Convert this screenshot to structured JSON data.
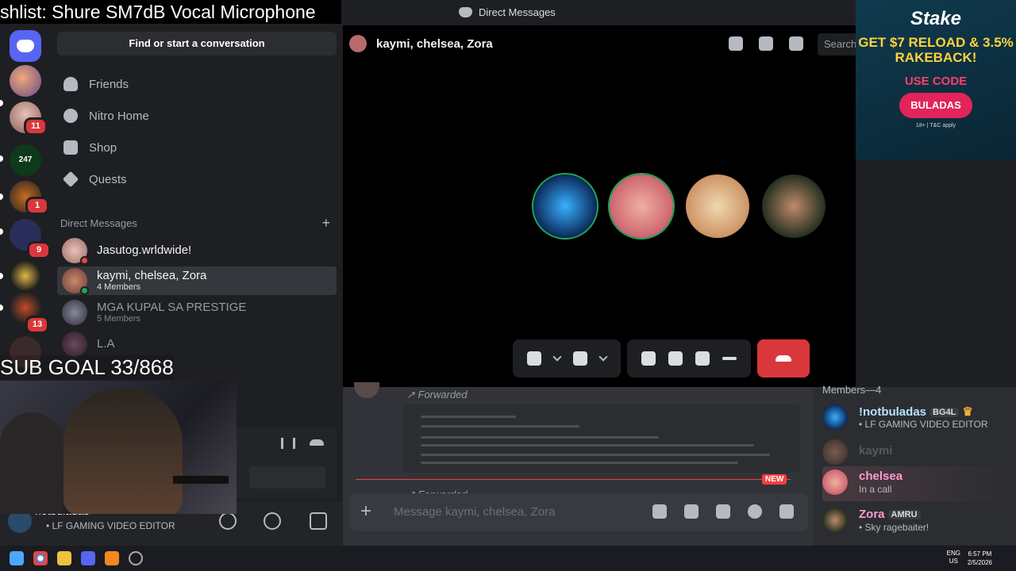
{
  "stream": {
    "title": "shlist: Shure SM7dB Vocal Microphone",
    "sub_goal": "SUB GOAL 33/868"
  },
  "window": {
    "title": "Direct Messages"
  },
  "rail": {
    "badges": [
      "11",
      "1",
      "9",
      "13"
    ]
  },
  "sidebar": {
    "find_label": "Find or start a conversation",
    "nav": [
      {
        "label": "Friends",
        "icon": "friends-icon"
      },
      {
        "label": "Nitro Home",
        "icon": "nitro-icon"
      },
      {
        "label": "Shop",
        "icon": "shop-icon"
      },
      {
        "label": "Quests",
        "icon": "quests-icon"
      }
    ],
    "dm_header": "Direct Messages",
    "dm_add": "+",
    "dms": [
      {
        "name": "Jasutog.wrldwide!",
        "sub": ""
      },
      {
        "name": "kaymi, chelsea, Zora",
        "sub": "4 Members"
      },
      {
        "name": "MGA KUPAL SA PRESTIGE",
        "sub": "5 Members"
      },
      {
        "name": "L.A",
        "sub": ""
      }
    ]
  },
  "user": {
    "name": "notbuladas",
    "status": "• LF GAMING VIDEO EDITOR"
  },
  "call": {
    "title": "kaymi, chelsea, Zora",
    "search_placeholder": "Search"
  },
  "chat": {
    "forwarded_label": "↗ Forwarded",
    "new_label": "NEW",
    "placeholder": "Message kaymi, chelsea, Zora"
  },
  "members": {
    "header": "Members—4",
    "list": [
      {
        "name": "!notbuladas",
        "tag": "BG4L",
        "status": "• LF GAMING VIDEO EDITOR",
        "color": "#b5e3ff"
      },
      {
        "name": "kaymi",
        "tag": "",
        "status": "",
        "color": "#6d6f78"
      },
      {
        "name": "chelsea",
        "tag": "",
        "status": "In a call",
        "color": "#ff9ad1"
      },
      {
        "name": "Zora",
        "tag": "AMRU",
        "status": "• Sky ragebaiter!",
        "color": "#ff9ad1"
      }
    ]
  },
  "ad": {
    "brand": "Stake",
    "headline": "GET $7 RELOAD & 3.5% RAKEBACK!",
    "use_code": "USE CODE",
    "code": "BULADAS",
    "terms": "18+ | T&C apply"
  },
  "taskbar": {
    "lang": "ENG",
    "region": "US",
    "time": "6:57 PM",
    "date": "2/5/2026"
  }
}
